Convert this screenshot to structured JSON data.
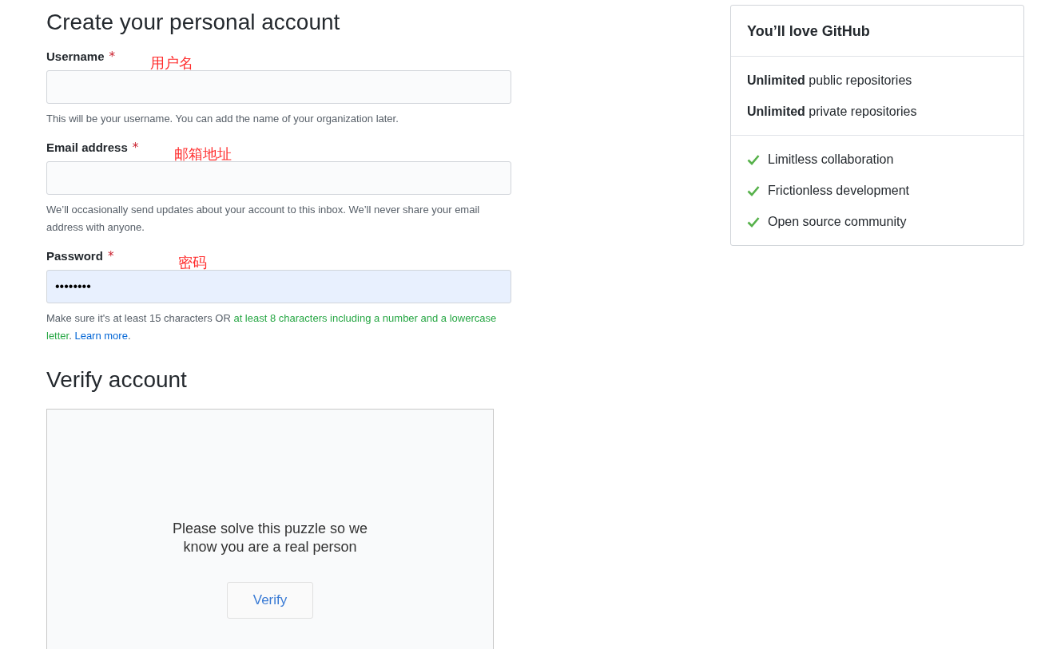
{
  "form": {
    "title": "Create your personal account",
    "fields": [
      {
        "label": "Username",
        "required_mark": "*",
        "annotation": "用户名",
        "focused": false,
        "hint": [
          {
            "kind": "plain",
            "text": "This will be your username. You can add the name of your organization later."
          }
        ]
      },
      {
        "label": "Email address",
        "required_mark": "*",
        "annotation": "邮箱地址",
        "focused": false,
        "hint": [
          {
            "kind": "plain",
            "text": "We’ll occasionally send updates about your account to this inbox. We’ll never share your email address with anyone."
          }
        ]
      },
      {
        "label": "Password",
        "required_mark": "*",
        "annotation": "密码",
        "value": "••••••••",
        "focused": true,
        "hint": [
          {
            "kind": "plain",
            "text": "Make sure it's at least 15 characters OR "
          },
          {
            "kind": "met",
            "text": "at least 8 characters including a number and a lowercase letter"
          },
          {
            "kind": "plain",
            "text": ". "
          },
          {
            "kind": "link",
            "text": "Learn more"
          },
          {
            "kind": "plain",
            "text": "."
          }
        ]
      }
    ]
  },
  "verify": {
    "title": "Verify account",
    "prompt": "Please solve this puzzle so we know you are a real person",
    "button": "Verify"
  },
  "card": {
    "title": "You’ll love GitHub",
    "plans": [
      "**Unlimited** public repositories",
      "**Unlimited** private repositories"
    ],
    "features": [
      "Limitless collaboration",
      "Frictionless development",
      "Open source community"
    ]
  }
}
